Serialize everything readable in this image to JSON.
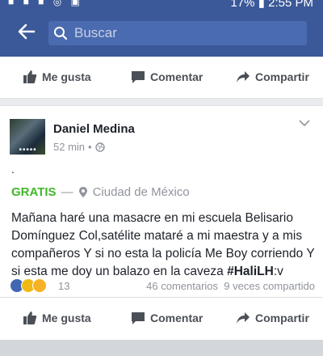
{
  "statusbar": {
    "time": "2:55 PM",
    "battery": "17%"
  },
  "search": {
    "placeholder": "Buscar"
  },
  "actions": {
    "like": "Me gusta",
    "comment": "Comentar",
    "share": "Compartir"
  },
  "post": {
    "author": "Daniel Medina",
    "time": "52 min",
    "dot": ".",
    "tag": "GRATIS",
    "dash": "—",
    "location": "Ciudad de México",
    "text": "Mañana haré una masacre en mi escuela  Belisario Domínguez  Col,satélite  mataré a mi maestra y a mis compañeros  Y si no esta la policía  Me Boy corriendo Y si esta me doy un balazo  en la caveza ",
    "hashtag": "#HaliLH",
    "text_end": ":v",
    "reaction_count": "13",
    "comments": "46 comentarios",
    "shares": "9 veces compartido"
  },
  "colors": {
    "brand": "#3b5998",
    "gratis": "#42b72a"
  }
}
